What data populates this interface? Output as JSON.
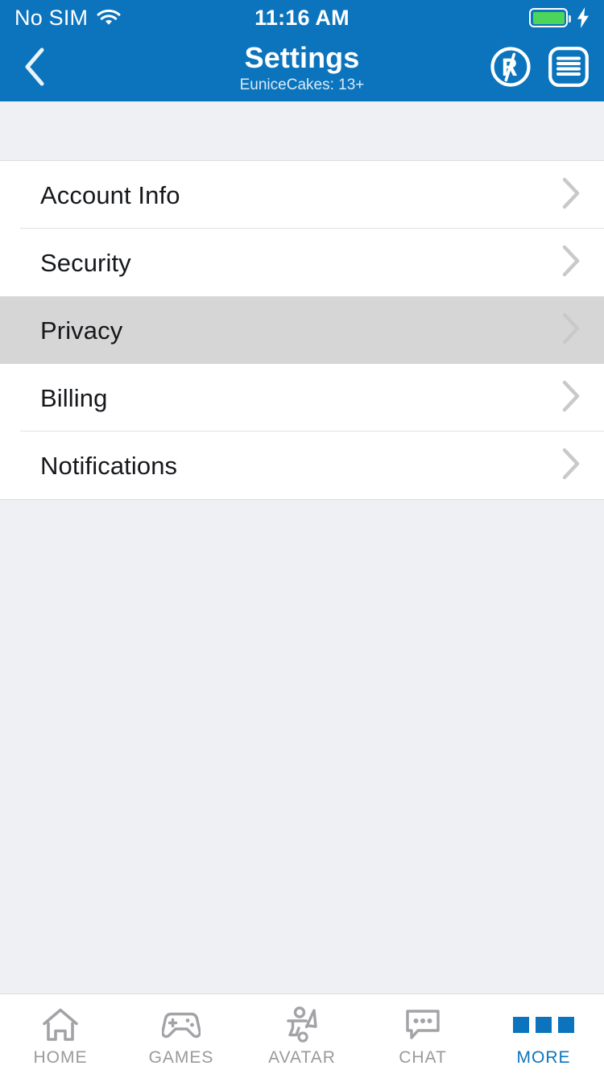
{
  "colors": {
    "header_blue": "#0b74bd",
    "page_bg": "#eff0f3",
    "row_bg": "#ffffff",
    "row_pressed_bg": "#d6d6d6",
    "accent": "#0b74bd",
    "tab_inactive": "#9a9a9e",
    "battery_green": "#4cd55b",
    "chevron_gray": "#c9c9cc"
  },
  "status_bar": {
    "carrier": "No SIM",
    "wifi_icon": "wifi-icon",
    "time": "11:16 AM",
    "battery_icon": "battery-icon",
    "battery_level_pct": 100,
    "charging_icon": "lightning-bolt-icon"
  },
  "nav_bar": {
    "back_icon": "chevron-left-icon",
    "title": "Settings",
    "subtitle": "EuniceCakes: 13+",
    "robux_icon": "robux-icon",
    "robux_label": "R$",
    "menu_icon": "list-menu-icon"
  },
  "settings_list": {
    "rows": [
      {
        "label": "Account Info",
        "chevron_icon": "chevron-right-icon",
        "pressed": false
      },
      {
        "label": "Security",
        "chevron_icon": "chevron-right-icon",
        "pressed": false
      },
      {
        "label": "Privacy",
        "chevron_icon": "chevron-right-icon",
        "pressed": true
      },
      {
        "label": "Billing",
        "chevron_icon": "chevron-right-icon",
        "pressed": false
      },
      {
        "label": "Notifications",
        "chevron_icon": "chevron-right-icon",
        "pressed": false
      }
    ]
  },
  "tab_bar": {
    "tabs": [
      {
        "label": "HOME",
        "icon": "home-icon",
        "active": false
      },
      {
        "label": "GAMES",
        "icon": "gamepad-icon",
        "active": false
      },
      {
        "label": "AVATAR",
        "icon": "avatar-icon",
        "active": false
      },
      {
        "label": "CHAT",
        "icon": "chat-bubble-icon",
        "active": false
      },
      {
        "label": "MORE",
        "icon": "more-dots-icon",
        "active": true
      }
    ]
  }
}
